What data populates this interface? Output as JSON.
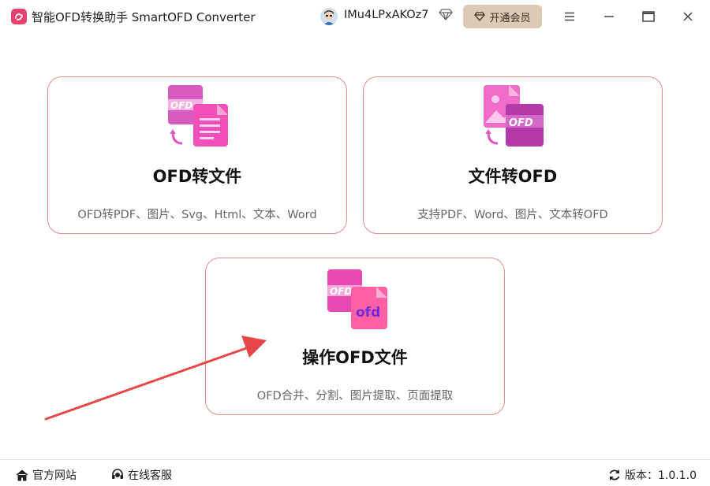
{
  "app": {
    "title": "智能OFD转换助手 SmartOFD Converter"
  },
  "header": {
    "username": "IMu4LPxAKOz7",
    "vip_label": "开通会员"
  },
  "cards": [
    {
      "title": "OFD转文件",
      "desc": "OFD转PDF、图片、Svg、Html、文本、Word",
      "icon_badge": "OFD"
    },
    {
      "title": "文件转OFD",
      "desc": "支持PDF、Word、图片、文本转OFD",
      "icon_badge": "OFD"
    },
    {
      "title": "操作OFD文件",
      "desc": "OFD合并、分割、图片提取、页面提取",
      "icon_badge": "OFD",
      "icon_badge2": "ofd"
    }
  ],
  "footer": {
    "website": "官方网站",
    "support": "在线客服",
    "version": "版本：1.0.1.0"
  },
  "colors": {
    "card_border": "#e58a8f",
    "accent_pink": "#e8416f",
    "vip_bg": "#dccab4",
    "arrow": "#e64848"
  }
}
